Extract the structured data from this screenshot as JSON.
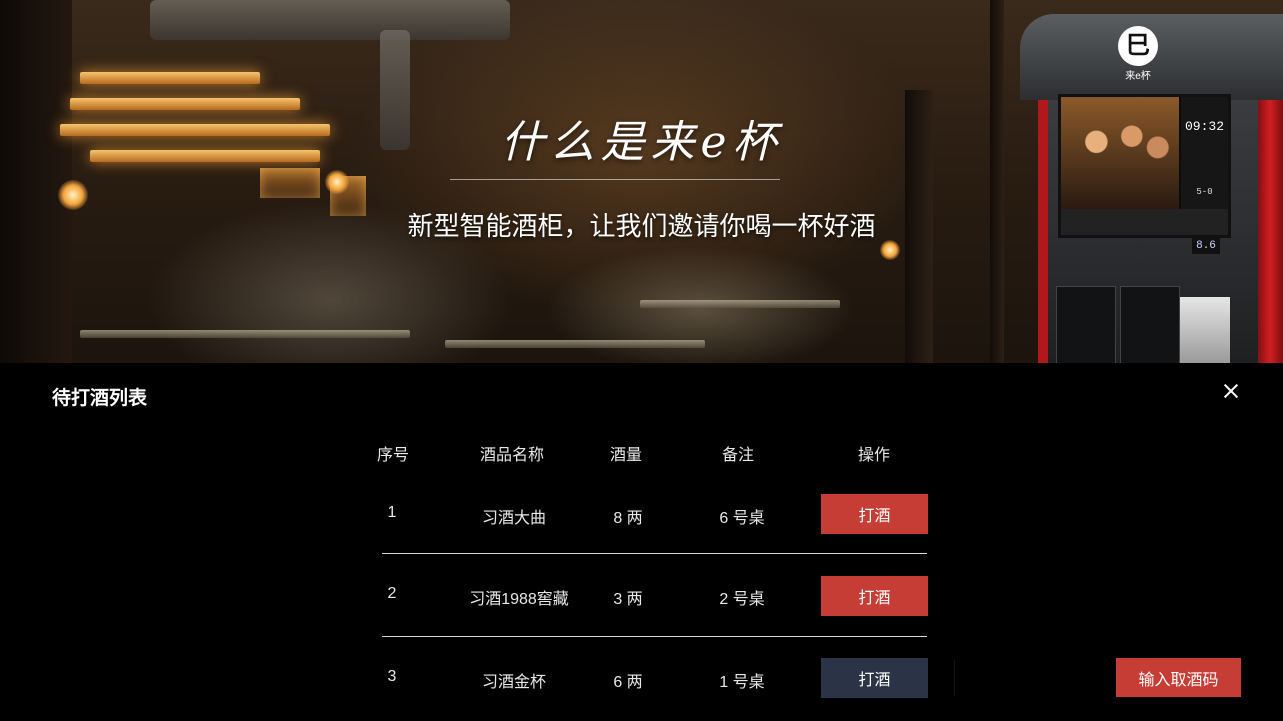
{
  "hero": {
    "title": "什么是来e杯",
    "subtitle": "新型智能酒柜，让我们邀请你喝一杯好酒"
  },
  "machine": {
    "logo_mark": "巳",
    "logo_text": "来e杯",
    "screen_time": "09:32",
    "screen_score": "5-0",
    "display_digits": "8.6"
  },
  "panel": {
    "title": "待打酒列表",
    "close_icon": "close-icon"
  },
  "table": {
    "headers": [
      "序号",
      "酒品名称",
      "酒量",
      "备注",
      "操作"
    ],
    "rows": [
      {
        "no": "1",
        "name": "习酒大曲",
        "amount": "8 两",
        "note": "6 号桌",
        "action": "打酒"
      },
      {
        "no": "2",
        "name": "习酒1988窖藏",
        "amount": "3 两",
        "note": "2 号桌",
        "action": "打酒"
      },
      {
        "no": "3",
        "name": "习酒金杯",
        "amount": "6 两",
        "note": "1 号桌",
        "action": "打酒"
      }
    ]
  },
  "footer": {
    "code_button": "输入取酒码"
  },
  "colors": {
    "accent_red": "#c53d34",
    "hover_navy": "#2b3446",
    "background": "#000000"
  }
}
